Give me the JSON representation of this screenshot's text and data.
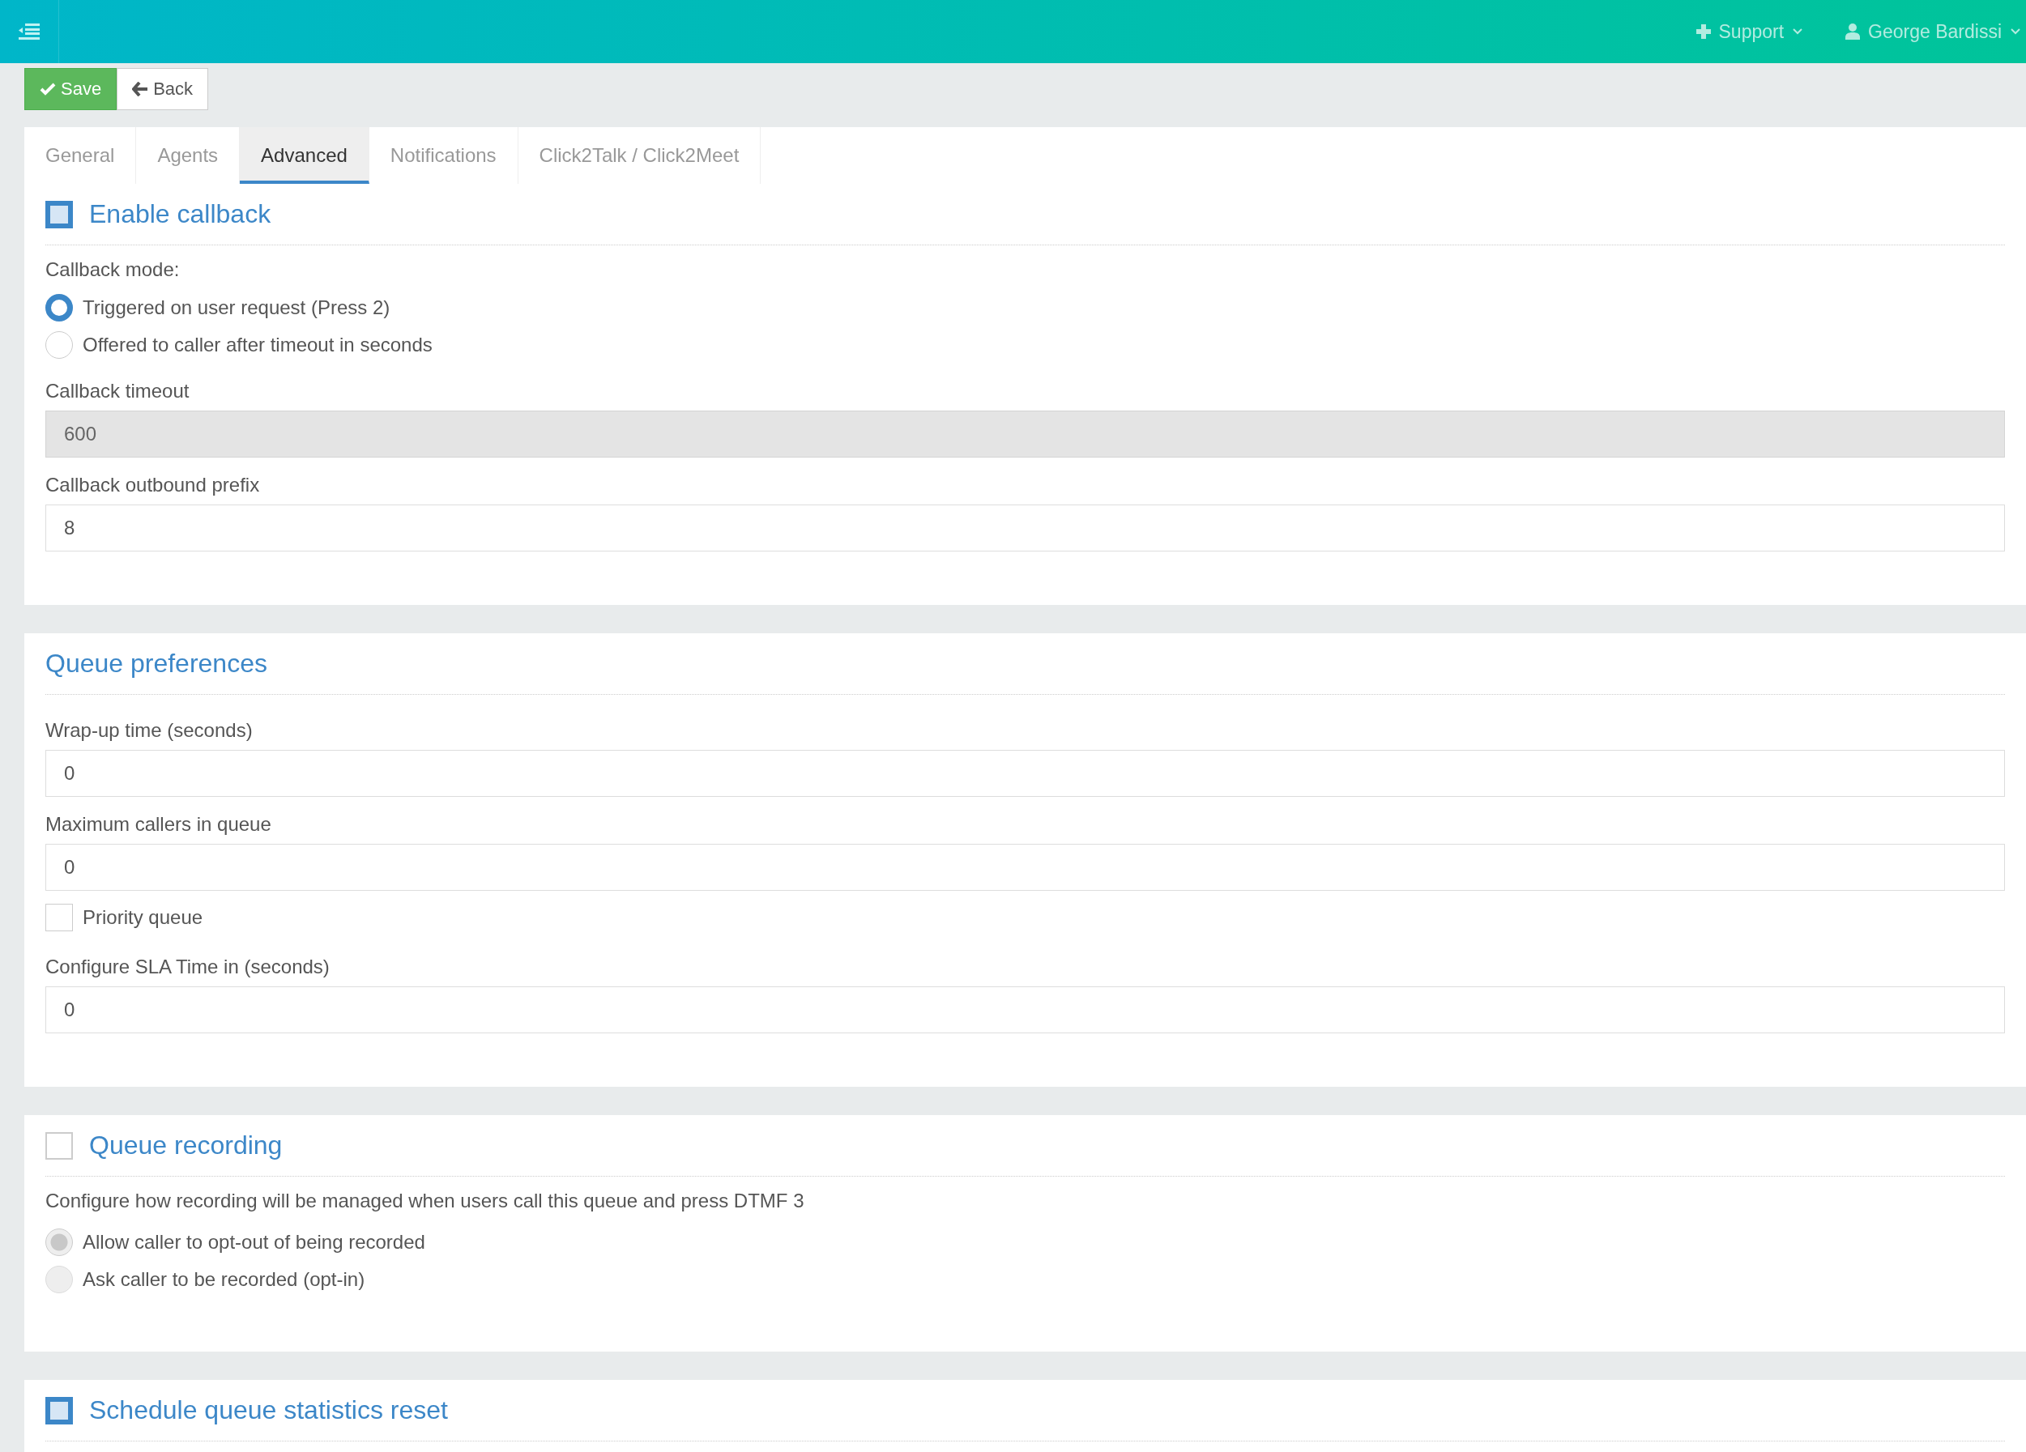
{
  "topbar": {
    "support": "Support",
    "user": "George Bardissi"
  },
  "toolbar": {
    "save": "Save",
    "back": "Back"
  },
  "tabs": [
    {
      "label": "General",
      "selected": false
    },
    {
      "label": "Agents",
      "selected": false
    },
    {
      "label": "Advanced",
      "selected": true
    },
    {
      "label": "Notifications",
      "selected": false
    },
    {
      "label": "Click2Talk / Click2Meet",
      "selected": false
    }
  ],
  "sections": [
    {
      "kind": "checkbox-heading",
      "title": "Enable callback",
      "checked": true,
      "items": [
        {
          "kind": "label",
          "text": "Callback mode:"
        },
        {
          "kind": "radio",
          "label": "Triggered on user request (Press 2)",
          "selected": true,
          "disabled": false
        },
        {
          "kind": "radio",
          "label": "Offered to caller after timeout in seconds",
          "selected": false,
          "disabled": false
        },
        {
          "kind": "field",
          "label": "Callback timeout",
          "value": "600",
          "disabled": true
        },
        {
          "kind": "field",
          "label": "Callback outbound prefix",
          "value": "8",
          "disabled": false
        }
      ]
    },
    {
      "kind": "heading",
      "title": "Queue preferences",
      "items": [
        {
          "kind": "field",
          "label": "Wrap-up time (seconds)",
          "value": "0",
          "disabled": false
        },
        {
          "kind": "field",
          "label": "Maximum callers in queue",
          "value": "0",
          "disabled": false
        },
        {
          "kind": "checkbox",
          "label": "Priority queue",
          "checked": false
        },
        {
          "kind": "field",
          "label": "Configure SLA Time in (seconds)",
          "value": "0",
          "disabled": false
        }
      ]
    },
    {
      "kind": "checkbox-heading",
      "title": "Queue recording",
      "checked": false,
      "items": [
        {
          "kind": "text",
          "text": "Configure how recording will be managed when users call this queue and press DTMF 3"
        },
        {
          "kind": "radio",
          "label": "Allow caller to opt-out of being recorded",
          "selected": true,
          "disabled": true
        },
        {
          "kind": "radio",
          "label": "Ask caller to be recorded (opt-in)",
          "selected": false,
          "disabled": true
        }
      ]
    },
    {
      "kind": "checkbox-heading",
      "title": "Schedule queue statistics reset",
      "checked": true
    }
  ]
}
